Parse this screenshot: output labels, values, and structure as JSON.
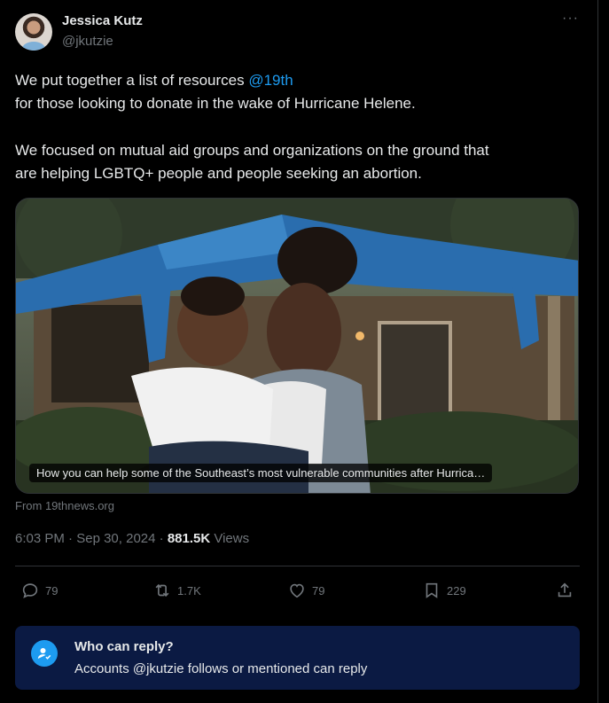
{
  "author": {
    "name": "Jessica Kutz",
    "handle": "@jkutzie"
  },
  "more_label": "···",
  "body": {
    "line1_prefix": "We put together a list of resources ",
    "line1_mention": "@19th",
    "line2": "for those looking to donate in the wake of Hurricane Helene.",
    "para2_line1": "We focused on mutual aid groups and  organizations on the ground that",
    "para2_line2": "are helping LGBTQ+ people and people seeking an abortion."
  },
  "card": {
    "caption": "How you can help some of the Southeast’s most vulnerable communities after Hurrica…",
    "source": "From 19thnews.org"
  },
  "meta": {
    "time": "6:03 PM",
    "sep1": " · ",
    "date": "Sep 30, 2024",
    "sep2": " · ",
    "views_count": "881.5K",
    "views_label": " Views"
  },
  "actions": {
    "replies": "79",
    "reposts": "1.7K",
    "likes": "79",
    "bookmarks": "229"
  },
  "reply_notice": {
    "title": "Who can reply?",
    "subtitle": "Accounts @jkutzie follows or mentioned can reply"
  },
  "colors": {
    "accent": "#1d9bf0",
    "notice_bg": "#0b1a43",
    "muted": "#71767b"
  }
}
